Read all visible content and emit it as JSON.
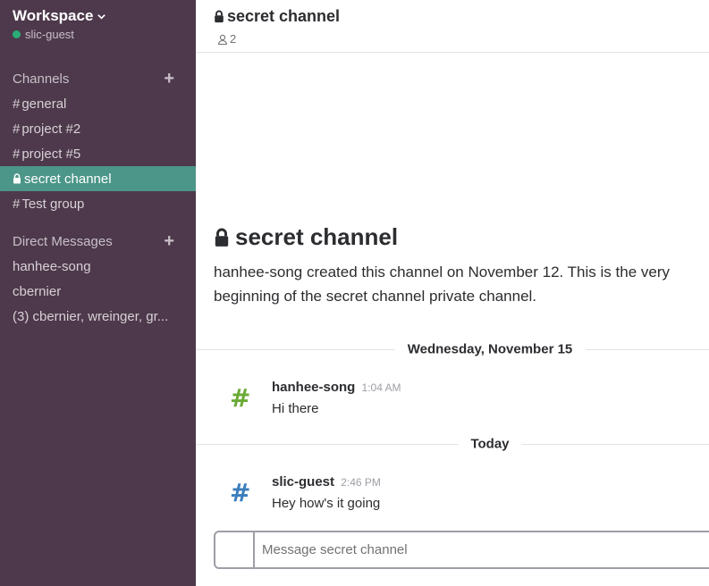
{
  "workspace": {
    "name": "Workspace",
    "user": "slic-guest"
  },
  "sidebar": {
    "channels_title": "Channels",
    "channels": [
      {
        "label": "general",
        "icon": "hash"
      },
      {
        "label": "project #2",
        "icon": "hash"
      },
      {
        "label": "project #5",
        "icon": "hash"
      },
      {
        "label": "secret channel",
        "icon": "lock",
        "active": true
      },
      {
        "label": "Test group",
        "icon": "hash"
      }
    ],
    "dm_title": "Direct Messages",
    "dms": [
      {
        "label": "hanhee-song"
      },
      {
        "label": "cbernier"
      },
      {
        "label": "(3) cbernier, wreinger, gr..."
      }
    ]
  },
  "header": {
    "title": "secret channel",
    "member_count": "2"
  },
  "intro": {
    "title": "secret channel",
    "text": "hanhee-song created this channel on November 12. This is the very beginning of the secret channel private channel."
  },
  "days": [
    {
      "label": "Wednesday, November 15",
      "messages": [
        {
          "author": "hanhee-song",
          "time": "1:04 AM",
          "text": "Hi there",
          "avatar_color": "#6aaa35"
        }
      ]
    },
    {
      "label": "Today",
      "messages": [
        {
          "author": "slic-guest",
          "time": "2:46 PM",
          "text": "Hey how's it going",
          "avatar_color": "#3b7dbd"
        }
      ]
    }
  ],
  "composer": {
    "placeholder": "Message secret channel"
  },
  "colors": {
    "sidebar": "#4d394b",
    "active": "#4c9689",
    "presence": "#2bac76"
  }
}
